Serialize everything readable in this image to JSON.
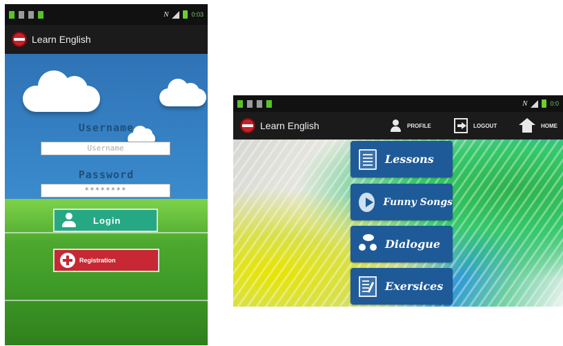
{
  "login_screen": {
    "status_bar": {
      "network_letter": "N",
      "time": "0:03"
    },
    "app_title": "Learn English",
    "username": {
      "label": "Username",
      "placeholder": "Username"
    },
    "password": {
      "label": "Password",
      "value": "********"
    },
    "login_button": "Login",
    "registration_button": "Registration"
  },
  "menu_screen": {
    "status_bar": {
      "network_letter": "N",
      "time": "0:0"
    },
    "app_title": "Learn English",
    "nav": {
      "profile": "PROFILE",
      "logout": "LOGOUT",
      "home": "HOME"
    },
    "menu": [
      {
        "label": "Lessons",
        "icon": "lessons-icon"
      },
      {
        "label": "Funny Songs",
        "icon": "play-icon"
      },
      {
        "label": "Dialogue",
        "icon": "dialogue-icon"
      },
      {
        "label": "Exersices",
        "icon": "exercises-icon"
      }
    ]
  },
  "colors": {
    "login_green": "#27a885",
    "registration_red": "#c72833",
    "menu_blue": "#1e5a98",
    "action_bar": "#1b1b1b"
  }
}
